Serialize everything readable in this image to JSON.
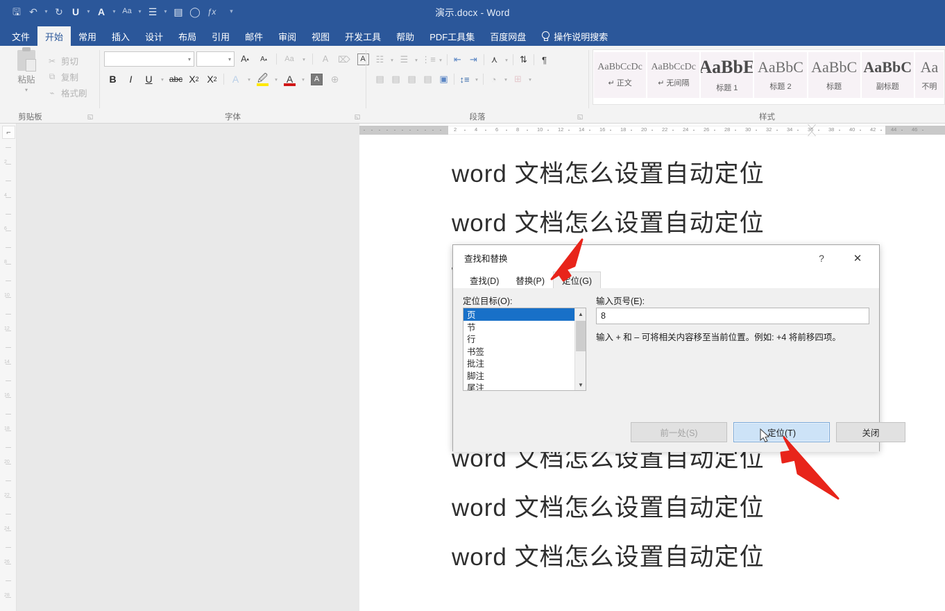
{
  "titlebar": {
    "document_title": "演示.docx  -  Word",
    "quick_access": [
      {
        "name": "save-icon",
        "glyph": "🖫"
      },
      {
        "name": "undo-icon",
        "glyph": "↶"
      },
      {
        "name": "redo-icon",
        "glyph": "↻"
      },
      {
        "name": "underline-icon",
        "glyph": "U"
      },
      {
        "name": "font-color-icon",
        "glyph": "A"
      },
      {
        "name": "change-case-icon",
        "glyph": "Aa"
      },
      {
        "name": "bullet-list-icon",
        "glyph": "☰"
      },
      {
        "name": "align-icon",
        "glyph": "▤"
      },
      {
        "name": "shape-icon",
        "glyph": "◯"
      },
      {
        "name": "formula-icon",
        "glyph": "ƒx"
      },
      {
        "name": "customize-qat-icon",
        "glyph": "▾"
      }
    ]
  },
  "ribbon": {
    "tabs": [
      {
        "label": "文件",
        "active": false
      },
      {
        "label": "开始",
        "active": true
      },
      {
        "label": "常用",
        "active": false
      },
      {
        "label": "插入",
        "active": false
      },
      {
        "label": "设计",
        "active": false
      },
      {
        "label": "布局",
        "active": false
      },
      {
        "label": "引用",
        "active": false
      },
      {
        "label": "邮件",
        "active": false
      },
      {
        "label": "审阅",
        "active": false
      },
      {
        "label": "视图",
        "active": false
      },
      {
        "label": "开发工具",
        "active": false
      },
      {
        "label": "帮助",
        "active": false
      },
      {
        "label": "PDF工具集",
        "active": false
      },
      {
        "label": "百度网盘",
        "active": false
      }
    ],
    "tell_me": "操作说明搜索",
    "groups": {
      "clipboard": {
        "label": "剪贴板",
        "paste": "粘贴",
        "commands": [
          {
            "label": "剪切",
            "icon": "scissors-icon",
            "glyph": "✂"
          },
          {
            "label": "复制",
            "icon": "copy-icon",
            "glyph": "⧉"
          },
          {
            "label": "格式刷",
            "icon": "format-painter-icon",
            "glyph": "🖌"
          }
        ]
      },
      "font": {
        "label": "字体",
        "font_name_value": "",
        "font_size_value": "",
        "buttons": [
          "grow-font",
          "shrink-font",
          "change-case",
          "phonetic-guide",
          "clear-formatting",
          "character-border",
          "bold",
          "italic",
          "underline",
          "strikethrough",
          "subscript",
          "superscript",
          "text-effects",
          "highlight",
          "font-color",
          "character-shading",
          "enclose-character"
        ]
      },
      "paragraph": {
        "label": "段落"
      },
      "styles": {
        "label": "样式",
        "items": [
          {
            "sample": "AaBbCcDc",
            "name": "正文",
            "size": 14,
            "bold": false,
            "pilcrow": true
          },
          {
            "sample": "AaBbCcDc",
            "name": "无间隔",
            "size": 14,
            "bold": false,
            "pilcrow": true
          },
          {
            "sample": "AaBbE",
            "name": "标题 1",
            "size": 26,
            "bold": true,
            "pilcrow": false
          },
          {
            "sample": "AaBbC",
            "name": "标题 2",
            "size": 22,
            "bold": false,
            "pilcrow": false
          },
          {
            "sample": "AaBbC",
            "name": "标题",
            "size": 22,
            "bold": false,
            "pilcrow": false
          },
          {
            "sample": "AaBbC",
            "name": "副标题",
            "size": 22,
            "bold": true,
            "pilcrow": false
          },
          {
            "sample": "Aa",
            "name": "不明",
            "size": 22,
            "bold": false,
            "pilcrow": false
          }
        ]
      }
    }
  },
  "document": {
    "lines": [
      "word 文档怎么设置自动定位",
      "word 文档怎么设置自动定位",
      "word 文档怎么设置自动定位",
      "word 文档怎么设置自动定位",
      "word 文档怎么设置自动定位",
      "word 文档怎么设置自动定位"
    ],
    "ruler_numbers": [
      "2",
      "4",
      "6",
      "8",
      "10",
      "12",
      "14",
      "16",
      "18",
      "20",
      "22",
      "24",
      "26",
      "28",
      "30",
      "32",
      "34",
      "36",
      "38",
      "40",
      "42",
      "44",
      "46"
    ]
  },
  "dialog": {
    "title": "查找和替换",
    "help_icon": "?",
    "close_icon": "✕",
    "tabs": [
      {
        "label": "查找(D)",
        "active": false
      },
      {
        "label": "替换(P)",
        "active": false
      },
      {
        "label": "定位(G)",
        "active": true
      }
    ],
    "goto_target_label": "定位目标(O):",
    "goto_targets": [
      "页",
      "节",
      "行",
      "书签",
      "批注",
      "脚注",
      "尾注"
    ],
    "goto_target_selected": "页",
    "page_number_label": "输入页号(E):",
    "page_number_value": "8",
    "hint": "输入 + 和 – 可将相关内容移至当前位置。例如: +4 将前移四项。",
    "buttons": [
      {
        "label": "前一处(S)",
        "state": "disabled"
      },
      {
        "label": "定位(T)",
        "state": "primary"
      },
      {
        "label": "关闭",
        "state": "normal"
      }
    ]
  },
  "annotations": {
    "arrow_color": "#e8241a",
    "arrow_to_goto_tab": "指向 定位(G) 选项卡",
    "arrow_to_goto_button": "指向 定位(T) 按钮"
  },
  "colors": {
    "titlebar": "#2b579a",
    "ribbon_bg": "#f3f3f3",
    "accent_selection": "#1870c8",
    "primary_button": "#cde3f7",
    "canvas": "#e9e9e9"
  }
}
